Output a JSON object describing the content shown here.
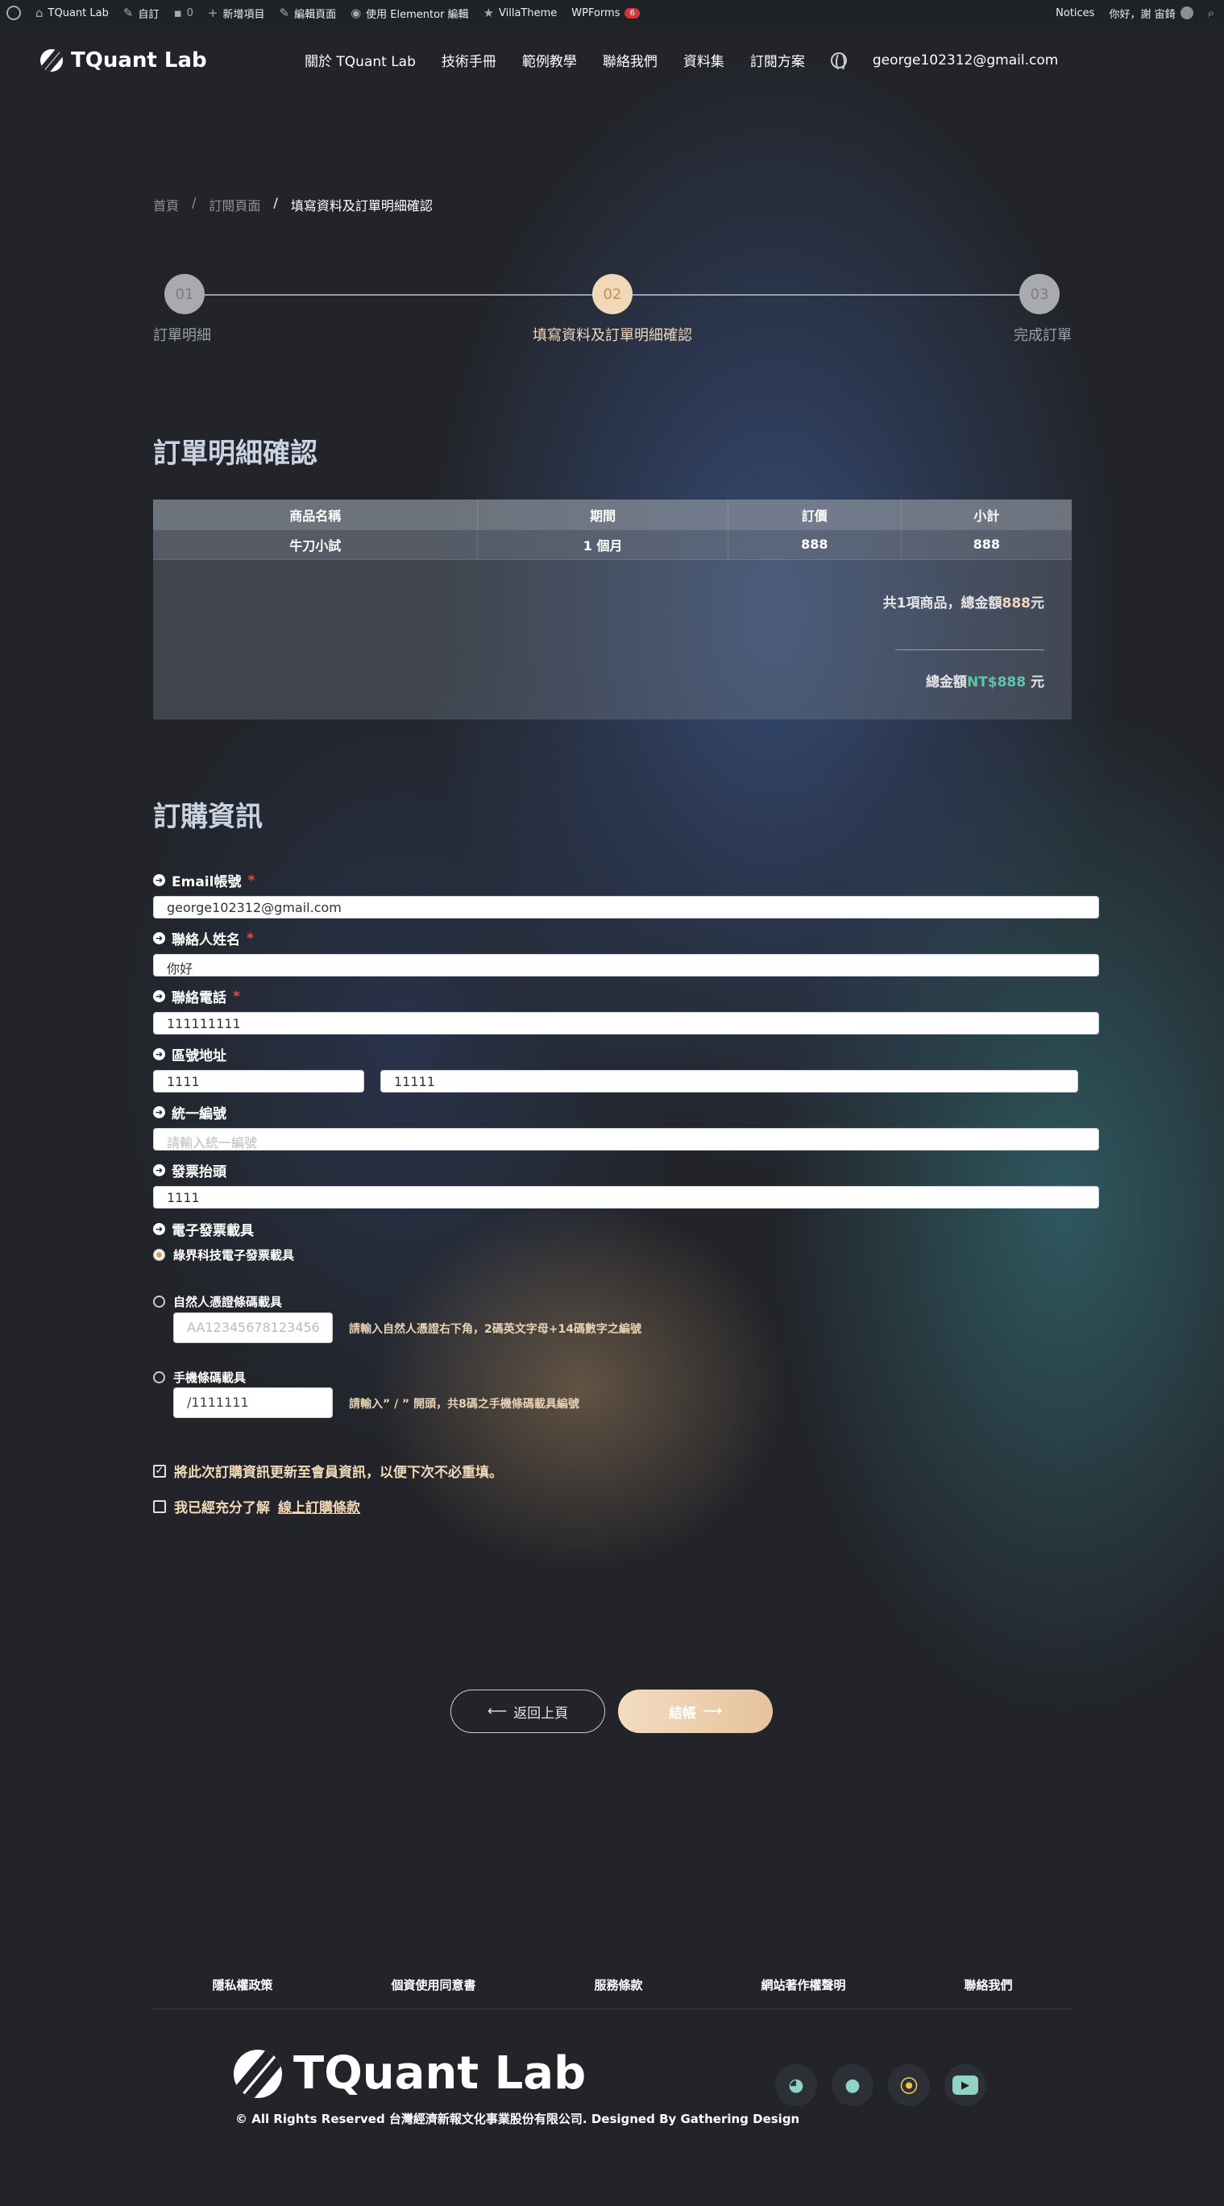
{
  "admin_bar": {
    "site_name": "TQuant Lab",
    "customize": "自訂",
    "comments_count": "0",
    "new_item": "新增項目",
    "edit_page": "編輯頁面",
    "elementor_edit": "使用 Elementor 編輯",
    "villa_theme": "VillaTheme",
    "wpforms": "WPForms",
    "wpforms_badge": "6",
    "notices": "Notices",
    "greeting": "你好，謝 宙錡"
  },
  "header": {
    "logo_text": "TQuant Lab",
    "nav": [
      "關於 TQuant Lab",
      "技術手冊",
      "範例教學",
      "聯絡我們",
      "資料集",
      "訂閱方案"
    ],
    "user_email": "george102312@gmail.com"
  },
  "breadcrumb": {
    "home": "首頁",
    "sep": "/",
    "subscription": "訂閱頁面",
    "current": "填寫資料及訂單明細確認"
  },
  "steps": [
    {
      "number": "01",
      "label": "訂單明細",
      "active": false
    },
    {
      "number": "02",
      "label": "填寫資料及訂單明細確認",
      "active": true
    },
    {
      "number": "03",
      "label": "完成訂單",
      "active": false
    }
  ],
  "order": {
    "title": "訂單明細確認",
    "columns": [
      "商品名稱",
      "期間",
      "訂價",
      "小計"
    ],
    "rows": [
      [
        "牛刀小試",
        "1 個月",
        "888",
        "888"
      ]
    ],
    "summary_prefix": "共1項商品，總金額",
    "summary_amount": "888",
    "summary_suffix": "元",
    "total_prefix": "總金額",
    "total_amount": "NT$888",
    "total_suffix": " 元"
  },
  "form": {
    "title": "訂購資訊",
    "email_label": "Email帳號",
    "email_value": "george102312@gmail.com",
    "name_label": "聯絡人姓名",
    "name_value": "你好",
    "phone_label": "聯絡電話",
    "phone_value": "111111111",
    "address_label": "區號地址",
    "zip_value": "1111",
    "address_value": "11111",
    "tax_id_label": "統一編號",
    "tax_id_placeholder": "請輸入統一編號",
    "invoice_title_label": "發票抬頭",
    "invoice_title_value": "1111",
    "carrier_label": "電子發票載具",
    "carrier_option_1": "綠界科技電子發票載具",
    "carrier_option_2": "自然人憑證條碼載具",
    "carrier_option_2_placeholder": "AA12345678123456",
    "carrier_option_2_hint": "請輸入自然人憑證右下角，2碼英文字母+14碼數字之編號",
    "carrier_option_3": "手機條碼載具",
    "carrier_option_3_value": "/1111111",
    "carrier_option_3_hint": "請輸入” / ” 開頭，共8碼之手機條碼載具編號",
    "update_member_info": "將此次訂購資訊更新至會員資訊，以便下次不必重填。",
    "agree_prefix": "我已經充分了解 ",
    "agree_link": "線上訂購條款",
    "required_mark": "*"
  },
  "buttons": {
    "back": "返回上頁",
    "checkout": "結帳"
  },
  "footer": {
    "links": [
      "隱私權政策",
      "個資使用同意書",
      "服務條款",
      "網站著作權聲明",
      "聯絡我們"
    ],
    "logo_text": "TQuant Lab",
    "copyright": "© All Rights Reserved 台灣經濟新報文化事業股份有限公司. Designed By Gathering Design",
    "socials": [
      "discord-icon",
      "github-icon",
      "tqlab-icon",
      "youtube-icon"
    ]
  },
  "colors": {
    "accent": "#f1d8b8",
    "total_green": "#5bc6a8",
    "background": "#222429"
  }
}
